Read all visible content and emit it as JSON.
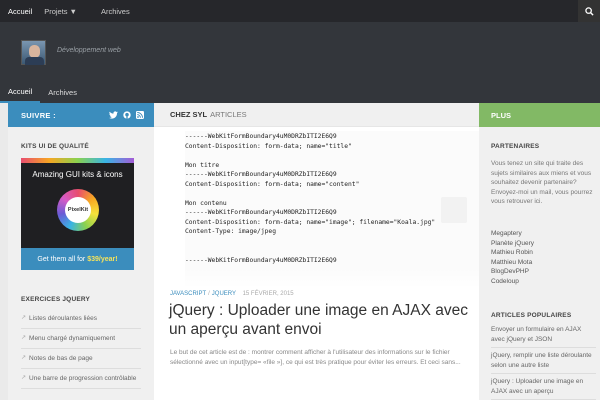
{
  "topbar": {
    "nav": [
      "Accueil",
      "Projets",
      "Archives"
    ]
  },
  "header": {
    "tagline": "Développement web",
    "subnav": [
      "Accueil",
      "Archives"
    ]
  },
  "left": {
    "follow_label": "SUIVRE :",
    "kits_title": "KITS UI DE QUALITÉ",
    "ad": {
      "headline": "Amazing GUI kits & icons",
      "logo": "PixelKit",
      "cta_prefix": "Get them all for",
      "cta_price": "$39/year!"
    },
    "exos_title": "EXERCICES JQUERY",
    "exos": [
      "Listes déroulantes liées",
      "Menu chargé dynamiquement",
      "Notes de bas de page",
      "Une barre de progression contrôlable"
    ]
  },
  "main": {
    "head_bold": "CHEZ SYL",
    "head_rest": "ARTICLES",
    "code_lines": [
      "------WebKitFormBoundary4uM0DRZbITI2E6Q9",
      "Content-Disposition: form-data; name=\"title\"",
      "",
      "Mon titre",
      "------WebKitFormBoundary4uM0DRZbITI2E6Q9",
      "Content-Disposition: form-data; name=\"content\"",
      "",
      "Mon contenu",
      "------WebKitFormBoundary4uM0DRZbITI2E6Q9",
      "Content-Disposition: form-data; name=\"image\"; filename=\"Koala.jpg\"",
      "Content-Type: image/jpeg",
      "",
      "",
      "------WebKitFormBoundary4uM0DRZbITI2E6Q9"
    ],
    "meta_cat1": "JAVASCRIPT",
    "meta_cat2": "JQUERY",
    "meta_date": "15 FÉVRIER, 2015",
    "post_title": "jQuery : Uploader une image en AJAX avec un aperçu avant envoi",
    "excerpt": "Le but de cet article est de : montrer comment afficher à l'utilisateur des informations sur le fichier sélectionné avec un input[type= «file »], ce qui est très pratique pour éviter les erreurs. Et ceci sans..."
  },
  "right": {
    "plus_label": "PLUS",
    "partners_title": "PARTENAIRES",
    "partners_text": "Vous tenez un site qui traite des sujets similaires aux miens et vous souhaitez devenir partenaire? Envoyez-moi un mail, vous pourrez vous retrouver ici.",
    "partners_links": [
      "Megaptery",
      "Planète jQuery",
      "Mathieu Robin",
      "Matthieu Mota",
      "BlogDevPHP",
      "Codeloup"
    ],
    "popular_title": "ARTICLES POPULAIRES",
    "popular": [
      "Envoyer un formulaire en AJAX avec jQuery et JSON",
      "jQuery, remplir une liste déroulante selon une autre liste",
      "jQuery : Uploader une image en AJAX avec un aperçu"
    ]
  },
  "colors": {
    "accent_blue": "#3b8dbd",
    "accent_green": "#82b965",
    "topbar": "#26272b",
    "header": "#33363b"
  },
  "icons": {
    "topbar": [
      "search-icon"
    ],
    "social": [
      "twitter-icon",
      "github-icon",
      "rss-icon"
    ],
    "list": [
      "external-link-icon"
    ]
  }
}
